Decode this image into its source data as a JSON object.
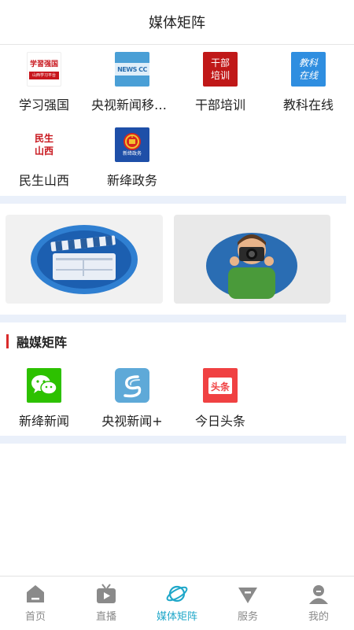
{
  "header": {
    "title": "媒体矩阵"
  },
  "matrix": {
    "items": [
      {
        "label": "学习强国",
        "icon": "xuexi-qiangguo-logo"
      },
      {
        "label": "央视新闻移动网",
        "icon": "cctv-news-logo"
      },
      {
        "label": "干部培训",
        "icon": "ganbu-peixun-logo"
      },
      {
        "label": "教科在线",
        "icon": "jiaoke-zaixian-logo"
      },
      {
        "label": "民生山西",
        "icon": "minsheng-shanxi-logo"
      },
      {
        "label": "新绛政务",
        "icon": "national-emblem-logo"
      }
    ],
    "logo_text": {
      "xuexi_title": "学習强国",
      "xuexi_sub": "山西学习平台",
      "cctv": "NEWS CC",
      "ganbu": "干部培训",
      "jiaoke": "教科在线",
      "minsheng": "民生山西",
      "zhengwu": "新绛政务"
    }
  },
  "banners": [
    {
      "name": "video-clapper-banner"
    },
    {
      "name": "photographer-banner"
    }
  ],
  "rongmei": {
    "title": "融媒矩阵",
    "items": [
      {
        "label": "新绛新闻",
        "icon": "wechat-logo"
      },
      {
        "label": "央视新闻+",
        "icon": "cctv-plus-logo"
      },
      {
        "label": "今日头条",
        "icon": "toutiao-logo"
      }
    ],
    "toutiao_logo_text": "头条"
  },
  "tabbar": {
    "tabs": [
      {
        "label": "首页",
        "icon": "home-icon",
        "active": false
      },
      {
        "label": "直播",
        "icon": "live-tv-icon",
        "active": false
      },
      {
        "label": "媒体矩阵",
        "icon": "planet-icon",
        "active": true
      },
      {
        "label": "服务",
        "icon": "diamond-icon",
        "active": false
      },
      {
        "label": "我的",
        "icon": "user-icon",
        "active": false
      }
    ]
  },
  "colors": {
    "accent": "#1fa7c9",
    "section_bar": "#d92b2b",
    "divider": "#eaf0fa",
    "tab_inactive": "#8a8a8a"
  }
}
